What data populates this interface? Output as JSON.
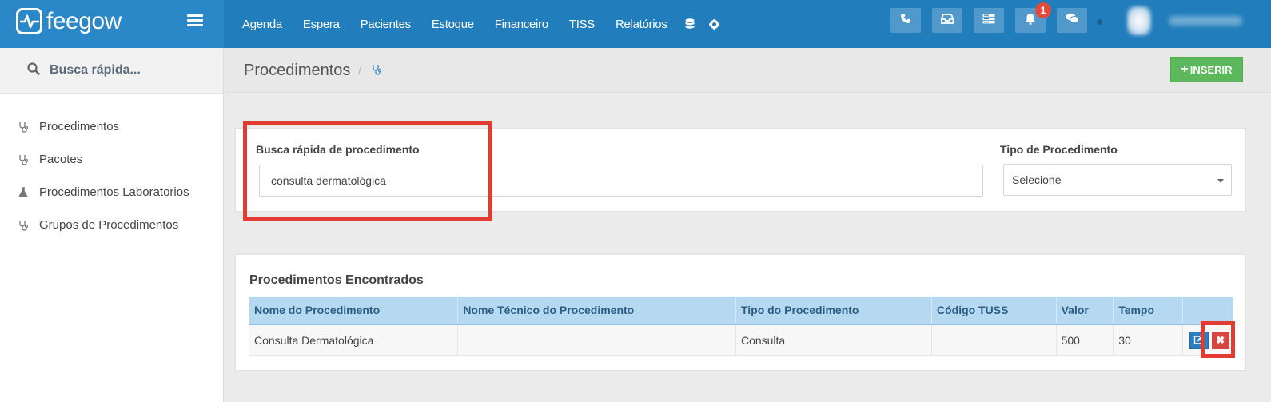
{
  "app": {
    "logo_text": "feegow"
  },
  "nav": {
    "items": [
      "Agenda",
      "Espera",
      "Pacientes",
      "Estoque",
      "Financeiro",
      "TISS",
      "Relatórios"
    ],
    "icons": [
      "database-icon",
      "gear-icon"
    ]
  },
  "topbar": {
    "buttons": [
      "phone-icon",
      "inbox-icon",
      "server-icon",
      "bell-icon",
      "chat-icon"
    ],
    "notification_count": "1"
  },
  "sidebar": {
    "search_placeholder": "Busca rápida...",
    "items": [
      {
        "label": "Procedimentos",
        "icon": "stethoscope-icon"
      },
      {
        "label": "Pacotes",
        "icon": "stethoscope-icon"
      },
      {
        "label": "Procedimentos Laboratorios",
        "icon": "flask-icon"
      },
      {
        "label": "Grupos de Procedimentos",
        "icon": "stethoscope-icon"
      }
    ]
  },
  "header": {
    "title": "Procedimentos",
    "separator": "/",
    "insert_label": "INSERIR"
  },
  "filters": {
    "search_label": "Busca rápida de procedimento",
    "search_value": "consulta dermatológica",
    "type_label": "Tipo de Procedimento",
    "type_selected": "Selecione"
  },
  "results": {
    "title": "Procedimentos Encontrados",
    "columns": [
      "Nome do Procedimento",
      "Nome Técnico do Procedimento",
      "Tipo do Procedimento",
      "Código TUSS",
      "Valor",
      "Tempo"
    ],
    "rows": [
      {
        "nome": "Consulta Dermatológica",
        "nome_tecnico": "",
        "tipo": "Consulta",
        "codigo_tuss": "",
        "valor": "500",
        "tempo": "30"
      }
    ],
    "delete_glyph": "✖"
  },
  "colors": {
    "topbar": "#217dbb",
    "accent_green": "#5cb85c",
    "highlight": "#e23b32",
    "table_header": "#b6d9f2"
  }
}
